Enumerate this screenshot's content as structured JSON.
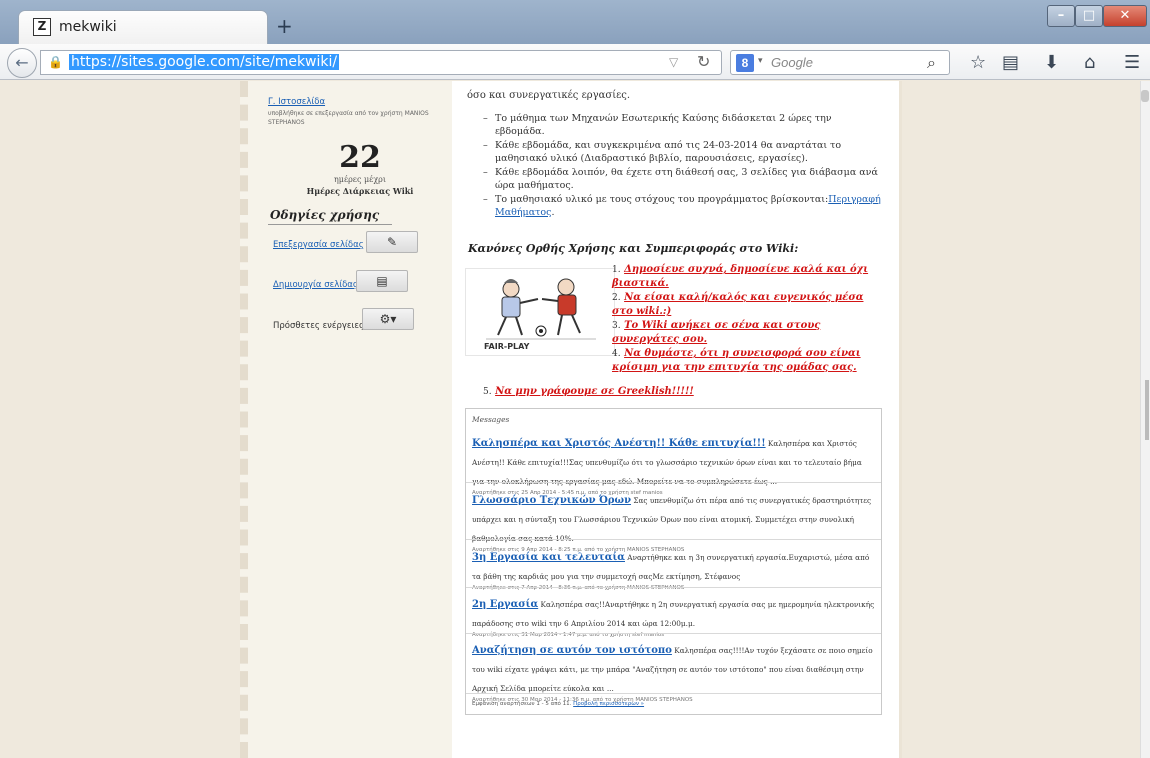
{
  "browser": {
    "tab_title": "mekwiki",
    "tab_favicon": "Z",
    "new_tab": "+",
    "url": "https://sites.google.com/site/mekwiki/",
    "search_placeholder": "Google",
    "search_engine_letter": "8"
  },
  "sidebar": {
    "last_edit_link": "Γ. Ιστοσελίδα",
    "last_edit_note": "υποβλήθηκε σε επεξεργασία από τον χρήστη MANIOS STEPHANOS",
    "countdown_number": "22",
    "countdown_sub": "ημέρες μέχρι",
    "countdown_label": "Ημέρες Διάρκειας Wiki",
    "guide_title": "Οδηγίες χρήσης",
    "actions": [
      {
        "label": "Επεξεργασία σελίδας",
        "icon": "pencil-icon"
      },
      {
        "label": "Δημιουργία σελίδας",
        "icon": "new-page-icon"
      },
      {
        "label": "Πρόσθετες ενέργειες",
        "icon": "gear-icon"
      }
    ]
  },
  "main": {
    "intro_tail": "όσο και συνεργατικές εργασίες.",
    "bullets": [
      "Το μάθημα των Μηχανών Εσωτερικής Καύσης διδάσκεται 2 ώρες την εβδομάδα.",
      "Κάθε εβδομάδα, και συγκεκριμένα από τις 24-03-2014 θα αναρτάται το μαθησιακό υλικό (Διαδραστικό βιβλίο, παρουσιάσεις, εργασίες).",
      "Κάθε εβδομάδα λοιπόν, θα έχετε στη διάθεσή σας, 3 σελίδες για διάβασμα ανά ώρα μαθήματος."
    ],
    "bullet4_text": "Το μαθησιακό υλικό με τους στόχους του προγράμματος βρίσκονται:",
    "bullet4_link": "Περιγραφή Μαθήματος",
    "bullet4_end": ".",
    "rules_title": "Κανόνες Ορθής Χρήσης και Συμπεριφοράς στο Wiki:",
    "image_caption": "FAIR-PLAY",
    "rules": [
      {
        "n": "1.",
        "t": "Δημοσίευε συχνά, δημοσίευε καλά και όχι βιαστικά."
      },
      {
        "n": "2.",
        "t": "Να είσαι καλή/καλός και ευγενικός μέσα στο wiki.:)"
      },
      {
        "n": "3.",
        "t": "Το Wiki ανήκει σε σένα και στους συνεργάτες σου."
      },
      {
        "n": "4.",
        "t": "Να θυμάστε, ότι η συνεισφορά σου είναι κρίσιμη για την επιτυχία της ομάδας σας."
      },
      {
        "n": "5.",
        "t": "Να μην γράφουμε σε Greeklish!!!!!"
      }
    ]
  },
  "messages": {
    "heading": "Messages",
    "posts": [
      {
        "title": "Καλησπέρα και Χριστός Ανέστη!! Κάθε επιτυχία!!!",
        "body": " Καλησπέρα και Χριστός Ανέστη!! Κάθε επιτυχία!!!Σας υπενθυμίζω ότι το γλωσσάριο τεχνικών όρων είναι και το τελευταίο βήμα για την ολοκλήρωση της εργασίας μας εδώ. Μπορείτε να το συμπληρώσετε έως ...",
        "meta": "Αναρτήθηκε στις 25 Απρ 2014 - 5:45 π.μ. από το χρήστη stef manios"
      },
      {
        "title": "Γλωσσάριο Τεχνικών Όρων",
        "body": " Σας υπενθυμίζω ότι πέρα από τις συνεργατικές δραστηριότητες υπάρχει και η σύνταξη του Γλωσσάριου Τεχνικών Όρων που είναι ατομική. Συμμετέχει στην συνολική βαθμολογία σας κατά 10%.",
        "meta": "Αναρτήθηκε στις 9 Απρ 2014 - 8:25 π.μ. από το χρήστη MANIOS STEPHANOS"
      },
      {
        "title": "3η Εργασία και τελευταία",
        "body": " Αναρτήθηκε και η 3η συνεργατική εργασία.Ευχαριστώ, μέσα από τα βάθη της καρδιάς μου για την συμμετοχή σαςΜε εκτίμηση, Στέφανος",
        "meta": "Αναρτήθηκε στις 7 Απρ 2014 - 8:36 π.μ. από το χρήστη MANIOS STEPHANOS"
      },
      {
        "title": "2η Εργασία",
        "body": " Καλησπέρα σας!!Αναρτήθηκε η 2η συνεργατική εργασία σας με ημερομηνία ηλεκτρονικής παράδοσης στο wiki την 6 Απριλίου 2014 και ώρα 12:00μ.μ.",
        "meta": "Αναρτήθηκε στις 31 Μαρ 2014 - 1:47 μ.μ. από το χρήστη stef manios"
      },
      {
        "title": "Αναζήτηση σε αυτόν τον ιστότοπο",
        "body": " Καλησπέρα σας!!!!Αν τυχόν ξεχάσατε σε ποιο σημείο του wiki είχατε γράψει κάτι, με την μπάρα \"Αναζήτηση σε αυτόν τον ιστότοπο\" που είναι διαθέσιμη στην  Αρχική Σελίδα μπορείτε εύκολα και ...",
        "meta": "Αναρτήθηκε στις 30 Μαρ 2014 - 11:36 π.μ. από το χρήστη MANIOS STEPHANOS"
      }
    ],
    "footer_text": "Εμφάνιση αναρτήσεων 1 - 5 από 11. ",
    "footer_link": "Προβολή περισσότερων »"
  }
}
